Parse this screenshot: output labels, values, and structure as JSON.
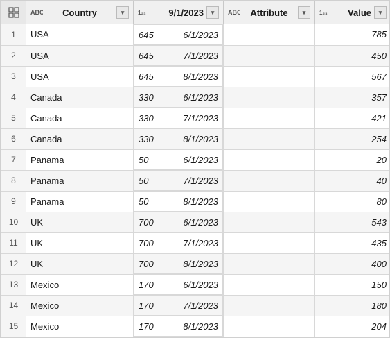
{
  "columns": [
    {
      "key": "index",
      "type": "grid",
      "label": "",
      "align": "center"
    },
    {
      "key": "country",
      "type": "ABC",
      "label": "Country",
      "align": "left"
    },
    {
      "key": "date",
      "type": "123",
      "label": "9/1/2023",
      "align": "right"
    },
    {
      "key": "attribute",
      "type": "ABC",
      "label": "Attribute",
      "align": "left"
    },
    {
      "key": "value",
      "type": "123",
      "label": "Value",
      "align": "right"
    }
  ],
  "rows": [
    {
      "index": 1,
      "country": "USA",
      "date": "645",
      "dateFormatted": "6/1/2023",
      "attribute": "",
      "value": "785"
    },
    {
      "index": 2,
      "country": "USA",
      "date": "645",
      "dateFormatted": "7/1/2023",
      "attribute": "",
      "value": "450"
    },
    {
      "index": 3,
      "country": "USA",
      "date": "645",
      "dateFormatted": "8/1/2023",
      "attribute": "",
      "value": "567"
    },
    {
      "index": 4,
      "country": "Canada",
      "date": "330",
      "dateFormatted": "6/1/2023",
      "attribute": "",
      "value": "357"
    },
    {
      "index": 5,
      "country": "Canada",
      "date": "330",
      "dateFormatted": "7/1/2023",
      "attribute": "",
      "value": "421"
    },
    {
      "index": 6,
      "country": "Canada",
      "date": "330",
      "dateFormatted": "8/1/2023",
      "attribute": "",
      "value": "254"
    },
    {
      "index": 7,
      "country": "Panama",
      "date": "50",
      "dateFormatted": "6/1/2023",
      "attribute": "",
      "value": "20"
    },
    {
      "index": 8,
      "country": "Panama",
      "date": "50",
      "dateFormatted": "7/1/2023",
      "attribute": "",
      "value": "40"
    },
    {
      "index": 9,
      "country": "Panama",
      "date": "50",
      "dateFormatted": "8/1/2023",
      "attribute": "",
      "value": "80"
    },
    {
      "index": 10,
      "country": "UK",
      "date": "700",
      "dateFormatted": "6/1/2023",
      "attribute": "",
      "value": "543"
    },
    {
      "index": 11,
      "country": "UK",
      "date": "700",
      "dateFormatted": "7/1/2023",
      "attribute": "",
      "value": "435"
    },
    {
      "index": 12,
      "country": "UK",
      "date": "700",
      "dateFormatted": "8/1/2023",
      "attribute": "",
      "value": "400"
    },
    {
      "index": 13,
      "country": "Mexico",
      "date": "170",
      "dateFormatted": "6/1/2023",
      "attribute": "",
      "value": "150"
    },
    {
      "index": 14,
      "country": "Mexico",
      "date": "170",
      "dateFormatted": "7/1/2023",
      "attribute": "",
      "value": "180"
    },
    {
      "index": 15,
      "country": "Mexico",
      "date": "170",
      "dateFormatted": "8/1/2023",
      "attribute": "",
      "value": "204"
    }
  ],
  "icons": {
    "abc": "ABC",
    "123": "123",
    "dropdown": "▾",
    "grid": "⊞"
  }
}
